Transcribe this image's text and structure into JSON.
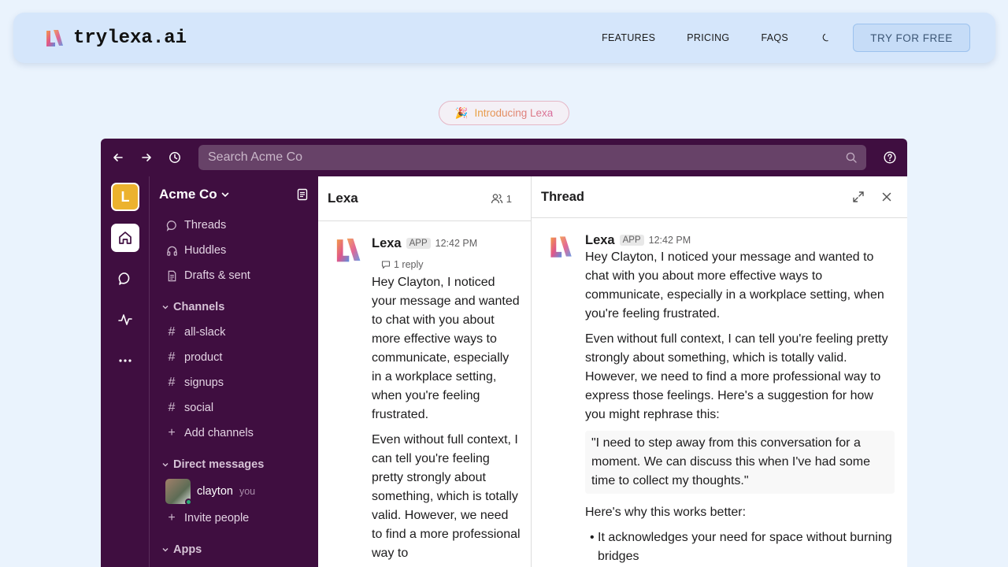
{
  "site": {
    "brand": "trylexa.ai",
    "nav": [
      "FEATURES",
      "PRICING",
      "FAQS"
    ],
    "cta": "TRY FOR FREE"
  },
  "pill": {
    "emoji": "🎉",
    "text": "Introducing Lexa"
  },
  "app": {
    "search_placeholder": "Search Acme Co",
    "workspace": {
      "initial": "L",
      "name": "Acme Co"
    },
    "sidebar": {
      "top_items": [
        "Threads",
        "Huddles",
        "Drafts & sent"
      ],
      "channels_label": "Channels",
      "channels": [
        "all-slack",
        "product",
        "signups",
        "social"
      ],
      "add_channels": "Add channels",
      "dm_label": "Direct messages",
      "dm_user": "clayton",
      "dm_you": "you",
      "invite": "Invite people",
      "apps_label": "Apps"
    },
    "channel": {
      "title": "Lexa",
      "member_count": "1",
      "author": "Lexa",
      "badge": "APP",
      "time": "12:42 PM",
      "reply_count": "1 reply",
      "paragraphs": [
        "Hey Clayton, I noticed your message and wanted to chat with you about more effective ways to communicate, especially in a workplace setting, when you're feeling frustrated.",
        "Even without full context, I can tell you're feeling pretty strongly about something, which is totally valid. However, we need to find a more professional way to"
      ]
    },
    "thread": {
      "title": "Thread",
      "author": "Lexa",
      "badge": "APP",
      "time": "12:42 PM",
      "p1": "Hey Clayton, I noticed your message and wanted to chat with you about more effective ways to communicate, especially in a workplace setting, when you're feeling frustrated.",
      "p2": "Even without full context, I can tell you're feeling pretty strongly about something, which is totally valid. However, we need to find a more professional way to express those feelings. Here's a suggestion for how you might rephrase this:",
      "quote": "\"I need to step away from this conversation for a moment. We can discuss this when I've had some time to collect my thoughts.\"",
      "why": "Here's why this works better:",
      "bullet1": "• It acknowledges your need for space without burning bridges"
    }
  }
}
